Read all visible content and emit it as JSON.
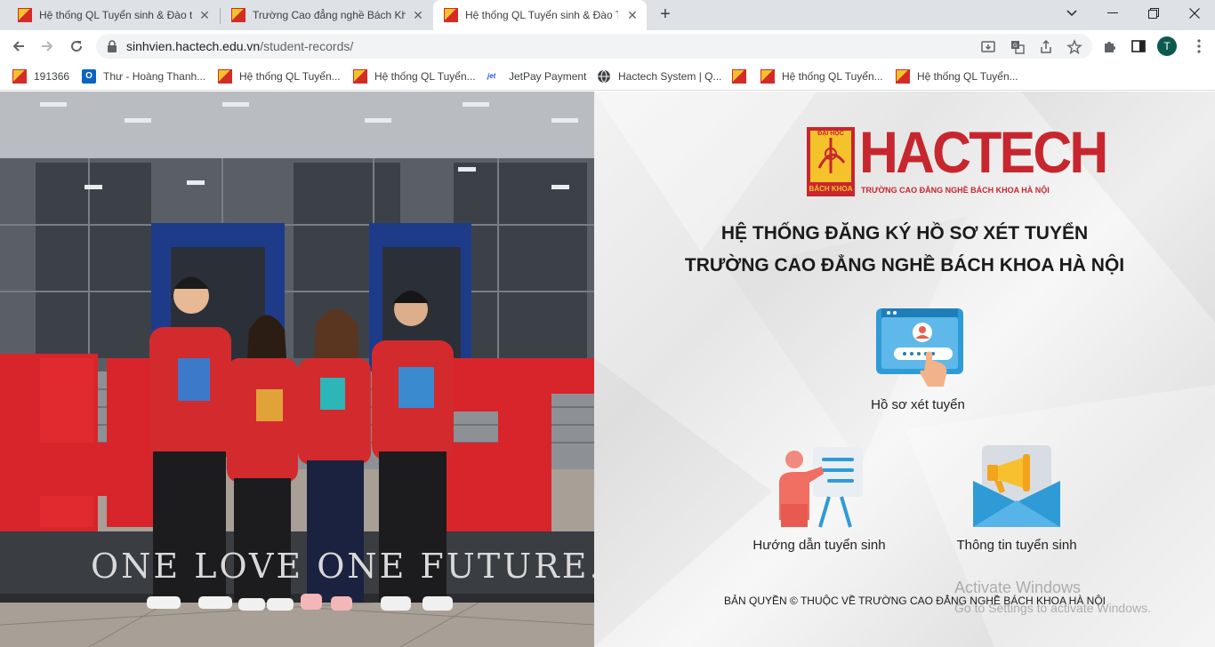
{
  "browser": {
    "tabs": [
      {
        "title": "Hệ thống QL Tuyển sinh & Đào tạo",
        "active": false
      },
      {
        "title": "Trường Cao đẳng nghề Bách Khoa",
        "active": false
      },
      {
        "title": "Hệ thống QL Tuyển sinh & Đào Tạo",
        "active": true
      }
    ],
    "url_host": "sinhvien.hactech.edu.vn",
    "url_path": "/student-records/",
    "profile_initial": "T",
    "bookmarks": [
      {
        "label": "191366",
        "icon": "hactech-favicon"
      },
      {
        "label": "Thư - Hoàng Thanh...",
        "icon": "outlook-icon"
      },
      {
        "label": "Hệ thống QL Tuyển...",
        "icon": "hactech-favicon"
      },
      {
        "label": "Hệ thống QL Tuyển...",
        "icon": "hactech-favicon"
      },
      {
        "label": "JetPay Payment",
        "icon": "jetpay-icon"
      },
      {
        "label": "Hactech System | Q...",
        "icon": "globe-icon"
      },
      {
        "label": "",
        "icon": "hactech-favicon"
      },
      {
        "label": "Hệ thống QL Tuyển...",
        "icon": "hactech-favicon"
      },
      {
        "label": "Hệ thống QL Tuyển...",
        "icon": "hactech-favicon"
      }
    ]
  },
  "photo": {
    "slogan": "ONE LOVE ONE FUTURE."
  },
  "logo": {
    "brand": "HACTECH",
    "tagline": "TRƯỜNG CAO ĐẲNG NGHỀ BÁCH KHOA HÀ NỘI",
    "emblem_top": "ĐẠI HỌC",
    "emblem_bottom": "BÁCH KHOA"
  },
  "page": {
    "heading_line1": "HỆ THỐNG ĐĂNG KÝ HỒ SƠ XÉT TUYỂN",
    "heading_line2": "TRƯỜNG CAO ĐẲNG NGHỀ BÁCH KHOA HÀ NỘI",
    "features": [
      {
        "label": "Hồ sơ xét tuyển",
        "icon": "profile-login-icon"
      },
      {
        "label": "Hướng dẫn tuyển sinh",
        "icon": "presentation-icon"
      },
      {
        "label": "Thông tin tuyển sinh",
        "icon": "megaphone-envelope-icon"
      }
    ],
    "copyright": "BẢN QUYỀN © THUỘC VỀ TRƯỜNG CAO ĐẲNG NGHỀ BÁCH KHOA HÀ NỘI"
  },
  "os_watermark": {
    "line1": "Activate Windows",
    "line2": "Go to Settings to activate Windows."
  },
  "colors": {
    "brand_red": "#c8262e",
    "brand_yellow": "#f4c22b",
    "jacket_red": "#d32a2e"
  }
}
